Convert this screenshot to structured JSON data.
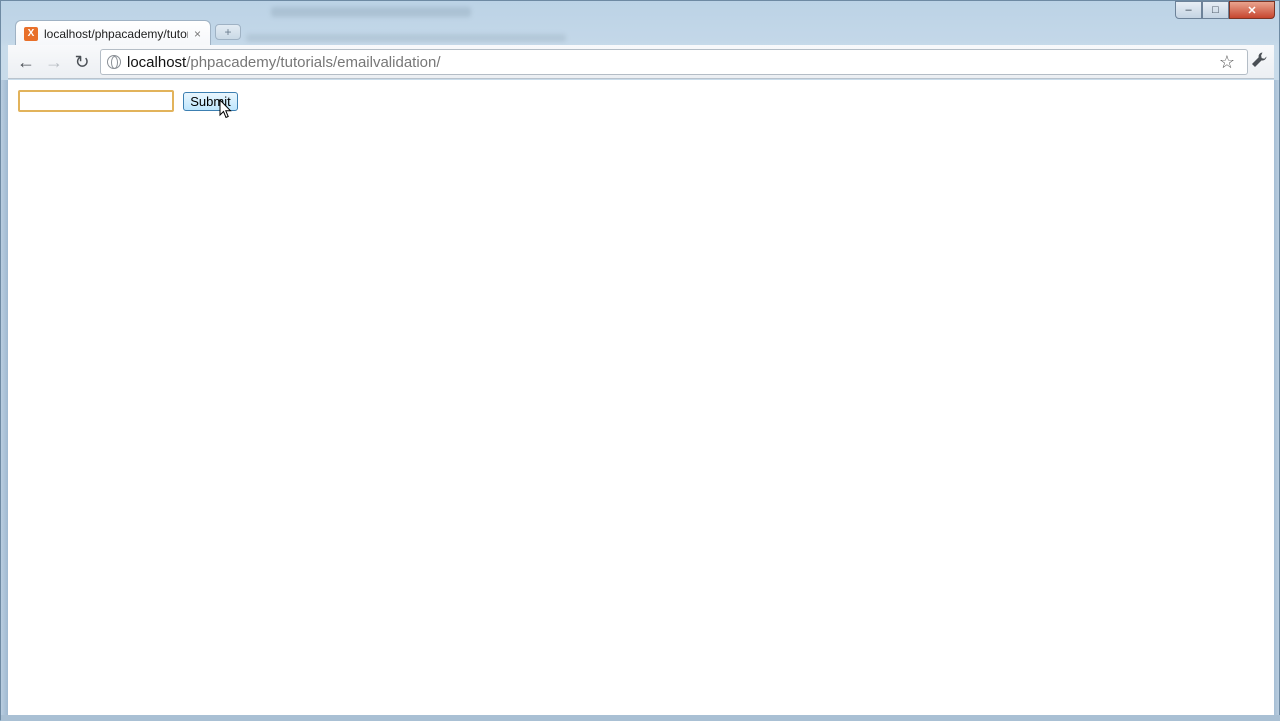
{
  "window": {
    "minimize_symbol": "–",
    "maximize_symbol": "□",
    "close_symbol": "✕"
  },
  "tab": {
    "title": "localhost/phpacademy/tutorials/emailvalidation/",
    "favicon_icon": "xampp-favicon-icon",
    "favicon_glyph": "X",
    "close_symbol": "×",
    "new_tab_symbol": "+"
  },
  "toolbar": {
    "back_symbol": "←",
    "forward_symbol": "→",
    "reload_symbol": "↻",
    "bookmark_symbol": "☆",
    "wrench_symbol": "🔧"
  },
  "omnibox": {
    "url_host": "localhost",
    "url_path": "/phpacademy/tutorials/emailvalidation/"
  },
  "form": {
    "email_value": "",
    "submit_label": "Submit"
  },
  "colors": {
    "input_focus_border": "#e2b35b",
    "button_border": "#3c7fb1",
    "favicon": "#e8702a"
  }
}
